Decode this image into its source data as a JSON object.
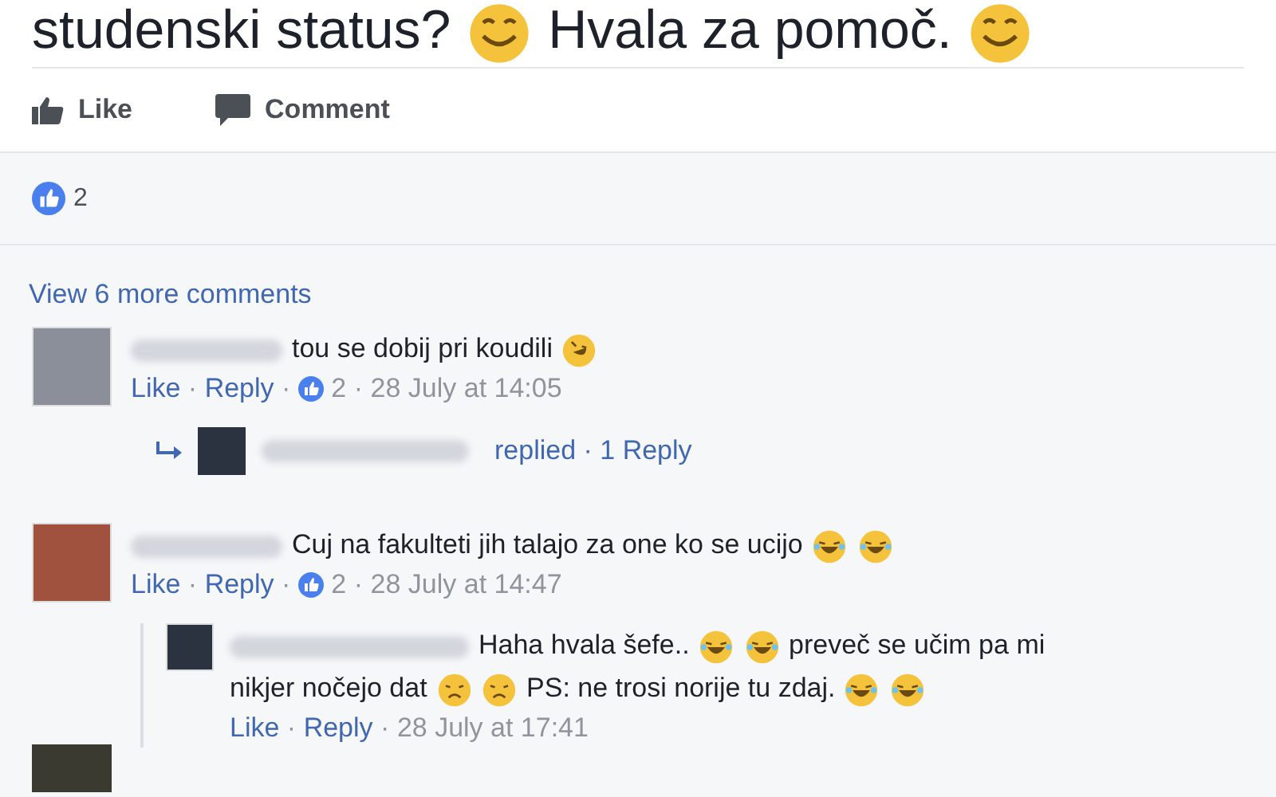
{
  "post": {
    "text": [
      {
        "kind": "text",
        "text": "studenski status?"
      },
      {
        "kind": "smile"
      },
      {
        "kind": "text",
        "text": "Hvala za pomoč."
      },
      {
        "kind": "smile"
      }
    ]
  },
  "actions": [
    {
      "kind": "like",
      "label": "Like"
    },
    {
      "kind": "comment",
      "label": "Comment"
    }
  ],
  "reactions": {
    "count": "2"
  },
  "view_more": "View 6 more comments",
  "comments": [
    {
      "text": [
        {
          "kind": "text",
          "text": "tou se dobij pri koudili"
        },
        {
          "kind": "rofl"
        }
      ],
      "meta": [
        {
          "kind": "link",
          "text": "Like"
        },
        {
          "kind": "sep",
          "text": "·"
        },
        {
          "kind": "link",
          "text": "Reply"
        },
        {
          "kind": "sep",
          "text": "·"
        },
        {
          "kind": "likes",
          "text": "2"
        },
        {
          "kind": "sep",
          "text": "·"
        },
        {
          "kind": "time",
          "text": "28 July at 14:05"
        }
      ],
      "replies_summary": {
        "text": "replied · 1 Reply"
      }
    },
    {
      "text": [
        {
          "kind": "text",
          "text": "Cuj na fakulteti jih talajo za one ko se ucijo"
        },
        {
          "kind": "joy"
        },
        {
          "kind": "joy"
        }
      ],
      "meta": [
        {
          "kind": "link",
          "text": "Like"
        },
        {
          "kind": "sep",
          "text": "·"
        },
        {
          "kind": "link",
          "text": "Reply"
        },
        {
          "kind": "sep",
          "text": "·"
        },
        {
          "kind": "likes",
          "text": "2"
        },
        {
          "kind": "sep",
          "text": "·"
        },
        {
          "kind": "time",
          "text": "28 July at 14:47"
        }
      ],
      "replies": [
        {
          "text": [
            {
              "kind": "text",
              "text": "Haha hvala šefe.."
            },
            {
              "kind": "joy"
            },
            {
              "kind": "joy"
            },
            {
              "kind": "text",
              "text": "preveč se učim pa mi"
            },
            {
              "kind": "text",
              "text": "nikjer nočejo dat"
            },
            {
              "kind": "tired"
            },
            {
              "kind": "tired"
            },
            {
              "kind": "text",
              "text": "PS: ne trosi norije tu zdaj."
            },
            {
              "kind": "joy"
            },
            {
              "kind": "joy"
            }
          ],
          "meta": [
            {
              "kind": "link",
              "text": "Like"
            },
            {
              "kind": "sep",
              "text": "·"
            },
            {
              "kind": "link",
              "text": "Reply"
            },
            {
              "kind": "sep",
              "text": "·"
            },
            {
              "kind": "time",
              "text": "28 July at 17:41"
            }
          ]
        }
      ]
    }
  ]
}
